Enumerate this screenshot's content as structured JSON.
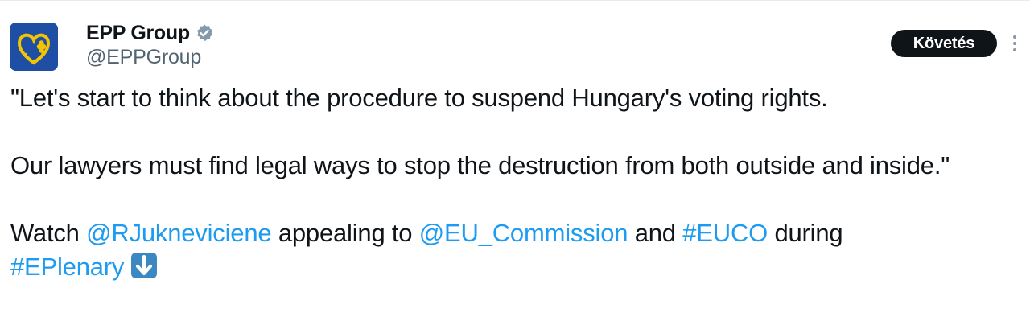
{
  "author": {
    "display_name": "EPP Group",
    "handle": "@EPPGroup",
    "verified_icon": "verified-badge-icon",
    "avatar_icon": "epp-logo-icon"
  },
  "actions": {
    "follow_label": "Követés",
    "more_icon": "more-vertical-icon"
  },
  "tweet": {
    "line1": "\"Let's start to think about the procedure to suspend Hungary's voting rights.",
    "line2": "Our lawyers must find legal ways to stop the destruction from both outside and inside.\"",
    "watch_prefix": "Watch ",
    "mention1": "@RJukneviciene",
    "middle1": " appealing to ",
    "mention2": "@EU_Commission",
    "middle2": " and ",
    "hashtag1": "#EUCO",
    "middle3": " during",
    "hashtag2": "#EPlenary",
    "emoji": "down-arrow-emoji-icon"
  },
  "colors": {
    "link": "#1d9bf0",
    "text": "#0f1419",
    "secondary": "#536471",
    "button_bg": "#0f1419",
    "avatar_bg": "#1f4fa5"
  }
}
